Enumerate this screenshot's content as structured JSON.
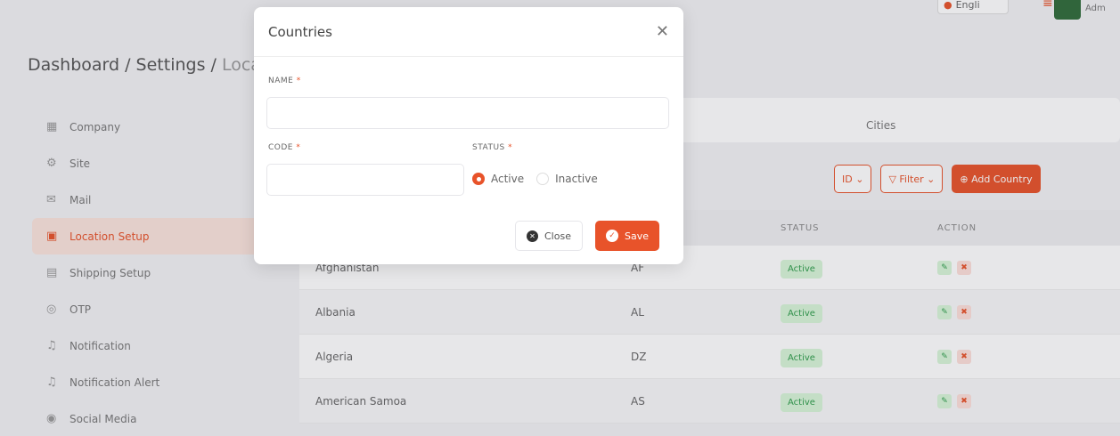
{
  "header": {
    "language": "Engli",
    "user_name": "Adm"
  },
  "breadcrumb": {
    "path": "Dashboard / Settings /",
    "current": "Loca"
  },
  "sidebar": {
    "items": [
      {
        "label": "Company",
        "icon": "building-icon"
      },
      {
        "label": "Site",
        "icon": "gear-icon"
      },
      {
        "label": "Mail",
        "icon": "mail-icon"
      },
      {
        "label": "Location Setup",
        "icon": "location-icon",
        "active": true
      },
      {
        "label": "Shipping Setup",
        "icon": "truck-icon"
      },
      {
        "label": "OTP",
        "icon": "lock-icon"
      },
      {
        "label": "Notification",
        "icon": "bell-icon"
      },
      {
        "label": "Notification Alert",
        "icon": "bell-icon"
      },
      {
        "label": "Social Media",
        "icon": "share-icon"
      }
    ]
  },
  "tabs": {
    "cities": "Cities"
  },
  "toolbar": {
    "sort": "ID",
    "filter": "Filter",
    "add": "Add Country"
  },
  "table": {
    "headers": [
      "STATUS",
      "ACTION"
    ],
    "rows": [
      {
        "name": "Afghanistan",
        "code": "AF",
        "status": "Active"
      },
      {
        "name": "Albania",
        "code": "AL",
        "status": "Active"
      },
      {
        "name": "Algeria",
        "code": "DZ",
        "status": "Active"
      },
      {
        "name": "American Samoa",
        "code": "AS",
        "status": "Active"
      }
    ]
  },
  "modal": {
    "title": "Countries",
    "name_label": "NAME",
    "name_value": "",
    "code_label": "CODE",
    "code_value": "",
    "status_label": "STATUS",
    "status_options": [
      "Active",
      "Inactive"
    ],
    "status_selected": "Active",
    "close_label": "Close",
    "save_label": "Save",
    "required_mark": "*"
  },
  "colors": {
    "accent": "#e8532a",
    "success": "#2e9d4b"
  }
}
